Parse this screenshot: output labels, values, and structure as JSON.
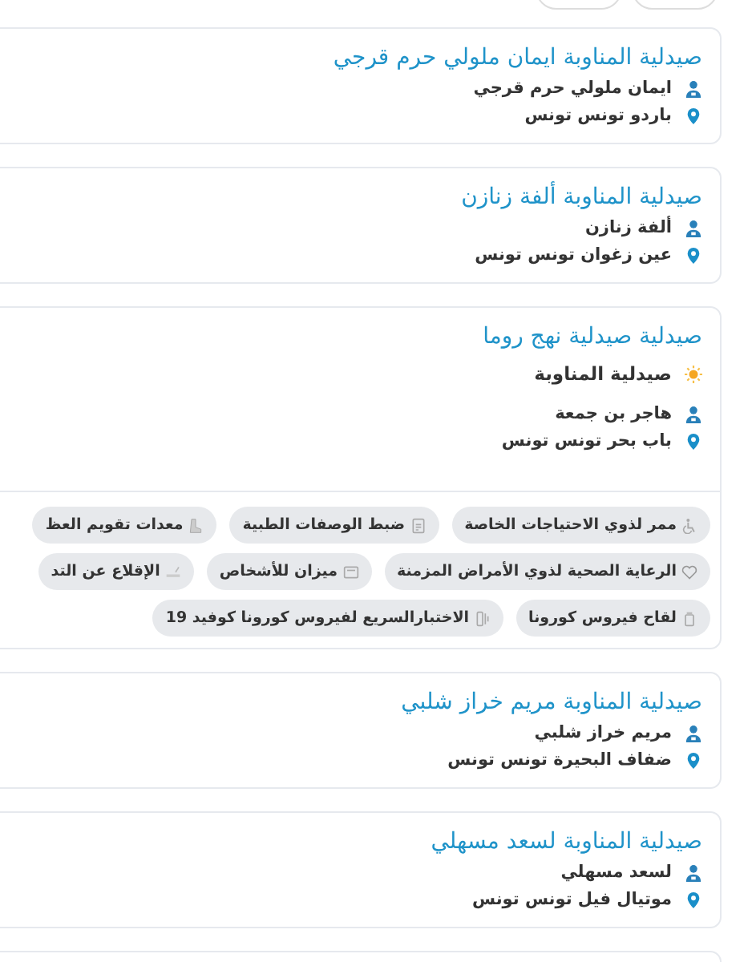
{
  "top_chips": [
    {
      "kind": "pill"
    },
    {
      "kind": "pill"
    }
  ],
  "pharmacies": [
    {
      "kind": "listing",
      "name": "صيدلية المناوبة ايمان ملولي حرم قرجي",
      "on_duty": false,
      "pharmacist": "ايمان ملولي حرم قرجي",
      "address": "باردو تونس تونس"
    },
    {
      "kind": "listing",
      "name": "صيدلية المناوبة ألفة زنازن",
      "on_duty": false,
      "pharmacist": "ألفة زنازن",
      "address": "عين زغوان تونس تونس"
    },
    {
      "kind": "listing",
      "name": "صيدلية صيدلية نهج روما",
      "on_duty": true,
      "duty_label": "صيدلية المناوبة",
      "pharmacist": "هاجر بن جمعة",
      "address": "باب بحر تونس تونس",
      "services": [
        [
          {
            "label": "ممر لذوي الاحتياجات الخاصة"
          },
          {
            "label": "ضبط الوصفات الطبية"
          },
          {
            "label": "معدات تقويم العظ"
          }
        ],
        [
          {
            "label": "الرعاية الصحية لذوي الأمراض المزمنة"
          },
          {
            "label": "ميزان للأشخاص"
          },
          {
            "label": "الإقلاع عن التد"
          }
        ],
        [
          {
            "label": "لقاح فيروس كورونا"
          },
          {
            "label": "الاختبارالسريع لفيروس كورونا كوفيد 19"
          }
        ]
      ]
    },
    {
      "kind": "listing",
      "name": "صيدلية المناوبة مريم خراز شلبي",
      "on_duty": false,
      "pharmacist": "مريم خراز شلبي",
      "address": "ضفاف البحيرة تونس تونس"
    },
    {
      "kind": "listing",
      "name": "صيدلية المناوبة لسعد مسهلي",
      "on_duty": false,
      "pharmacist": "لسعد مسهلي",
      "address": "موتيال فيل تونس تونس"
    },
    {
      "kind": "stub"
    }
  ]
}
